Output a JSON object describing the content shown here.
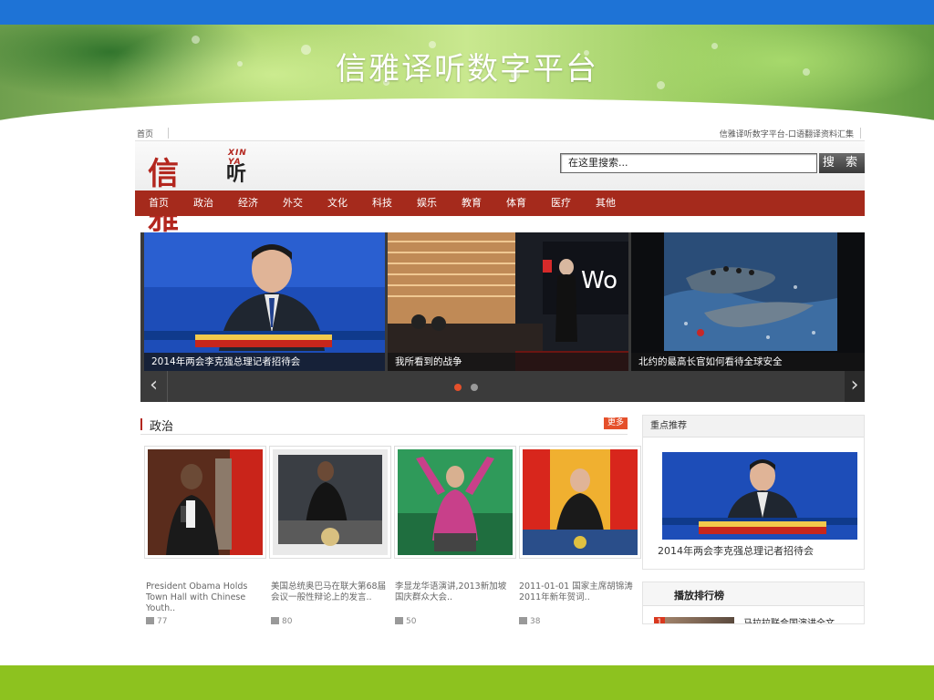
{
  "slide": {
    "title": "信雅译听数字平台"
  },
  "site": {
    "topbar": {
      "home_link": "首页",
      "right_text": "信雅译听数字平台-口语翻译资料汇集"
    },
    "logo": {
      "brand_big": "信雅",
      "brand_sub": "听译",
      "pinyin": "XIN YA"
    },
    "search": {
      "placeholder": "在这里搜索...",
      "button_label": "搜 索"
    },
    "nav": [
      "首页",
      "政治",
      "经济",
      "外交",
      "文化",
      "科技",
      "娱乐",
      "教育",
      "体育",
      "医疗",
      "其他"
    ],
    "carousel": {
      "slides": [
        {
          "caption": "2014年两会李克强总理记者招待会",
          "icon": "press-conference-image"
        },
        {
          "caption": "我所看到的战争",
          "icon": "ted-talk-image"
        },
        {
          "caption": "北约的最高长官如何看待全球安全",
          "icon": "boat-at-sea-image"
        }
      ],
      "prev_icon": "‹",
      "next_icon": "›",
      "active_dot_color": "#e5502b"
    },
    "politics": {
      "title": "政治",
      "more_label": "更多",
      "items": [
        {
          "text": "President Obama Holds Town Hall with Chinese Youth..",
          "plays": "77"
        },
        {
          "text": "美国总统奥巴马在联大第68届会议一般性辩论上的发言..",
          "plays": "80"
        },
        {
          "text": "李显龙华语演讲,2013新加坡国庆群众大会..",
          "plays": "50"
        },
        {
          "text": "2011-01-01 国家主席胡锦涛2011年新年贺词..",
          "plays": "38"
        }
      ]
    },
    "featured": {
      "title": "重点推荐",
      "caption": "2014年两会李克强总理记者招待会"
    },
    "ranking": {
      "title": "播放排行榜",
      "items": [
        {
          "num": "1",
          "text": "马拉拉联合国演讲全文"
        }
      ]
    }
  },
  "colors": {
    "top_blue": "#1e73d6",
    "bottom_green": "#8dc21f",
    "nav_red": "#a52a1c"
  }
}
